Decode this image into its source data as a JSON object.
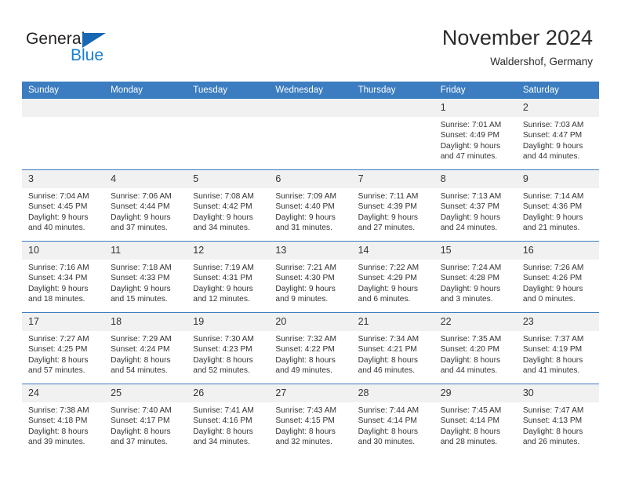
{
  "logo": {
    "word_primary": "General",
    "word_secondary": "Blue",
    "triangle_color": "#1668b3",
    "secondary_color": "#1a7fd4"
  },
  "header": {
    "title": "November 2024",
    "subtitle": "Waldershof, Germany",
    "accent_color": "#3b7dc0"
  },
  "calendar": {
    "weekday_headers": [
      "Sunday",
      "Monday",
      "Tuesday",
      "Wednesday",
      "Thursday",
      "Friday",
      "Saturday"
    ],
    "weeks": [
      [
        {
          "day": "",
          "empty": true
        },
        {
          "day": "",
          "empty": true
        },
        {
          "day": "",
          "empty": true
        },
        {
          "day": "",
          "empty": true
        },
        {
          "day": "",
          "empty": true
        },
        {
          "day": "1",
          "sunrise": "Sunrise: 7:01 AM",
          "sunset": "Sunset: 4:49 PM",
          "daylight_1": "Daylight: 9 hours",
          "daylight_2": "and 47 minutes."
        },
        {
          "day": "2",
          "sunrise": "Sunrise: 7:03 AM",
          "sunset": "Sunset: 4:47 PM",
          "daylight_1": "Daylight: 9 hours",
          "daylight_2": "and 44 minutes."
        }
      ],
      [
        {
          "day": "3",
          "sunrise": "Sunrise: 7:04 AM",
          "sunset": "Sunset: 4:45 PM",
          "daylight_1": "Daylight: 9 hours",
          "daylight_2": "and 40 minutes."
        },
        {
          "day": "4",
          "sunrise": "Sunrise: 7:06 AM",
          "sunset": "Sunset: 4:44 PM",
          "daylight_1": "Daylight: 9 hours",
          "daylight_2": "and 37 minutes."
        },
        {
          "day": "5",
          "sunrise": "Sunrise: 7:08 AM",
          "sunset": "Sunset: 4:42 PM",
          "daylight_1": "Daylight: 9 hours",
          "daylight_2": "and 34 minutes."
        },
        {
          "day": "6",
          "sunrise": "Sunrise: 7:09 AM",
          "sunset": "Sunset: 4:40 PM",
          "daylight_1": "Daylight: 9 hours",
          "daylight_2": "and 31 minutes."
        },
        {
          "day": "7",
          "sunrise": "Sunrise: 7:11 AM",
          "sunset": "Sunset: 4:39 PM",
          "daylight_1": "Daylight: 9 hours",
          "daylight_2": "and 27 minutes."
        },
        {
          "day": "8",
          "sunrise": "Sunrise: 7:13 AM",
          "sunset": "Sunset: 4:37 PM",
          "daylight_1": "Daylight: 9 hours",
          "daylight_2": "and 24 minutes."
        },
        {
          "day": "9",
          "sunrise": "Sunrise: 7:14 AM",
          "sunset": "Sunset: 4:36 PM",
          "daylight_1": "Daylight: 9 hours",
          "daylight_2": "and 21 minutes."
        }
      ],
      [
        {
          "day": "10",
          "sunrise": "Sunrise: 7:16 AM",
          "sunset": "Sunset: 4:34 PM",
          "daylight_1": "Daylight: 9 hours",
          "daylight_2": "and 18 minutes."
        },
        {
          "day": "11",
          "sunrise": "Sunrise: 7:18 AM",
          "sunset": "Sunset: 4:33 PM",
          "daylight_1": "Daylight: 9 hours",
          "daylight_2": "and 15 minutes."
        },
        {
          "day": "12",
          "sunrise": "Sunrise: 7:19 AM",
          "sunset": "Sunset: 4:31 PM",
          "daylight_1": "Daylight: 9 hours",
          "daylight_2": "and 12 minutes."
        },
        {
          "day": "13",
          "sunrise": "Sunrise: 7:21 AM",
          "sunset": "Sunset: 4:30 PM",
          "daylight_1": "Daylight: 9 hours",
          "daylight_2": "and 9 minutes."
        },
        {
          "day": "14",
          "sunrise": "Sunrise: 7:22 AM",
          "sunset": "Sunset: 4:29 PM",
          "daylight_1": "Daylight: 9 hours",
          "daylight_2": "and 6 minutes."
        },
        {
          "day": "15",
          "sunrise": "Sunrise: 7:24 AM",
          "sunset": "Sunset: 4:28 PM",
          "daylight_1": "Daylight: 9 hours",
          "daylight_2": "and 3 minutes."
        },
        {
          "day": "16",
          "sunrise": "Sunrise: 7:26 AM",
          "sunset": "Sunset: 4:26 PM",
          "daylight_1": "Daylight: 9 hours",
          "daylight_2": "and 0 minutes."
        }
      ],
      [
        {
          "day": "17",
          "sunrise": "Sunrise: 7:27 AM",
          "sunset": "Sunset: 4:25 PM",
          "daylight_1": "Daylight: 8 hours",
          "daylight_2": "and 57 minutes."
        },
        {
          "day": "18",
          "sunrise": "Sunrise: 7:29 AM",
          "sunset": "Sunset: 4:24 PM",
          "daylight_1": "Daylight: 8 hours",
          "daylight_2": "and 54 minutes."
        },
        {
          "day": "19",
          "sunrise": "Sunrise: 7:30 AM",
          "sunset": "Sunset: 4:23 PM",
          "daylight_1": "Daylight: 8 hours",
          "daylight_2": "and 52 minutes."
        },
        {
          "day": "20",
          "sunrise": "Sunrise: 7:32 AM",
          "sunset": "Sunset: 4:22 PM",
          "daylight_1": "Daylight: 8 hours",
          "daylight_2": "and 49 minutes."
        },
        {
          "day": "21",
          "sunrise": "Sunrise: 7:34 AM",
          "sunset": "Sunset: 4:21 PM",
          "daylight_1": "Daylight: 8 hours",
          "daylight_2": "and 46 minutes."
        },
        {
          "day": "22",
          "sunrise": "Sunrise: 7:35 AM",
          "sunset": "Sunset: 4:20 PM",
          "daylight_1": "Daylight: 8 hours",
          "daylight_2": "and 44 minutes."
        },
        {
          "day": "23",
          "sunrise": "Sunrise: 7:37 AM",
          "sunset": "Sunset: 4:19 PM",
          "daylight_1": "Daylight: 8 hours",
          "daylight_2": "and 41 minutes."
        }
      ],
      [
        {
          "day": "24",
          "sunrise": "Sunrise: 7:38 AM",
          "sunset": "Sunset: 4:18 PM",
          "daylight_1": "Daylight: 8 hours",
          "daylight_2": "and 39 minutes."
        },
        {
          "day": "25",
          "sunrise": "Sunrise: 7:40 AM",
          "sunset": "Sunset: 4:17 PM",
          "daylight_1": "Daylight: 8 hours",
          "daylight_2": "and 37 minutes."
        },
        {
          "day": "26",
          "sunrise": "Sunrise: 7:41 AM",
          "sunset": "Sunset: 4:16 PM",
          "daylight_1": "Daylight: 8 hours",
          "daylight_2": "and 34 minutes."
        },
        {
          "day": "27",
          "sunrise": "Sunrise: 7:43 AM",
          "sunset": "Sunset: 4:15 PM",
          "daylight_1": "Daylight: 8 hours",
          "daylight_2": "and 32 minutes."
        },
        {
          "day": "28",
          "sunrise": "Sunrise: 7:44 AM",
          "sunset": "Sunset: 4:14 PM",
          "daylight_1": "Daylight: 8 hours",
          "daylight_2": "and 30 minutes."
        },
        {
          "day": "29",
          "sunrise": "Sunrise: 7:45 AM",
          "sunset": "Sunset: 4:14 PM",
          "daylight_1": "Daylight: 8 hours",
          "daylight_2": "and 28 minutes."
        },
        {
          "day": "30",
          "sunrise": "Sunrise: 7:47 AM",
          "sunset": "Sunset: 4:13 PM",
          "daylight_1": "Daylight: 8 hours",
          "daylight_2": "and 26 minutes."
        }
      ]
    ]
  }
}
